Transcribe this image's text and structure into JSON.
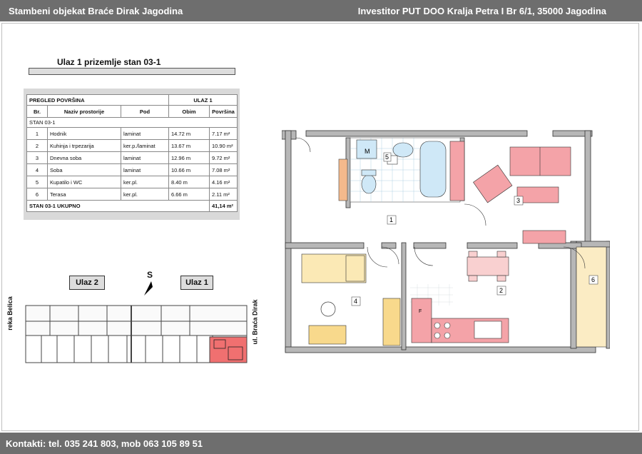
{
  "header": {
    "left_title": "Stambeni objekat Braće Dirak  Jagodina",
    "right_title": "Investitor PUT DOO Kralja Petra I Br 6/1, 35000 Jagodina"
  },
  "footer": {
    "contact": "Kontakti: tel. 035 241 803, mob 063 105 89 51"
  },
  "unit_heading": "Ulaz 1 prizemlje stan 03-1",
  "table": {
    "title": "PREGLED POVRŠINA",
    "entrance": "ULAZ 1",
    "columns": [
      "Br.",
      "Naziv prostorije",
      "Pod",
      "Obim",
      "Površina"
    ],
    "section": "STAN 03-1",
    "rows": [
      {
        "br": "1",
        "naziv": "Hodnik",
        "pod": "laminat",
        "obim": "14.72 m",
        "povrsina": "7.17 m²"
      },
      {
        "br": "2",
        "naziv": "Kuhinja i trpezarija",
        "pod": "ker.p./laminat",
        "obim": "13.67 m",
        "povrsina": "10.90 m²"
      },
      {
        "br": "3",
        "naziv": "Dnevna soba",
        "pod": "laminat",
        "obim": "12.96 m",
        "povrsina": "9.72 m²"
      },
      {
        "br": "4",
        "naziv": "Soba",
        "pod": "laminat",
        "obim": "10.66 m",
        "povrsina": "7.08 m²"
      },
      {
        "br": "5",
        "naziv": "Kupatilo i WC",
        "pod": "ker.pl.",
        "obim": "8.40 m",
        "povrsina": "4.16 m²"
      },
      {
        "br": "6",
        "naziv": "Terasa",
        "pod": "ker.pl.",
        "obim": "6.66 m",
        "povrsina": "2.11 m²"
      }
    ],
    "total_label": "STAN 03-1   UKUPNO",
    "total_value": "41,14 m²"
  },
  "site": {
    "entrance2": "Ulaz 2",
    "entrance1": "Ulaz 1",
    "north": "S",
    "river": "reka Belica",
    "street": "ul. Braća Dirak",
    "highlight_color": "#f07070"
  },
  "plan": {
    "room_labels": [
      "1",
      "2",
      "3",
      "4",
      "5",
      "6"
    ],
    "furniture_color": "#f4a3a8",
    "bed_color": "#fbe9b5",
    "wood_color": "#f8d98c",
    "bath_color": "#cfe8f7"
  }
}
